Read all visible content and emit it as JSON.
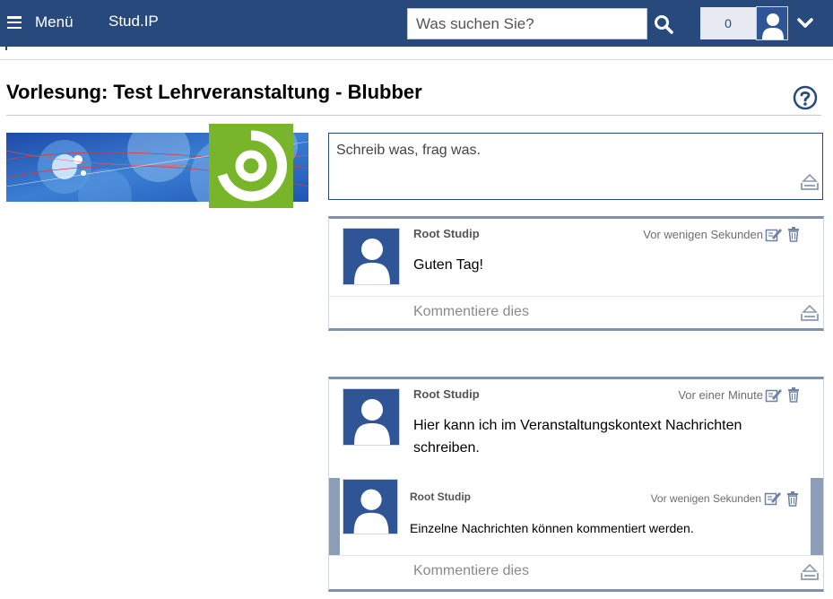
{
  "header": {
    "menu_label": "Menü",
    "brand": "Stud.IP",
    "search_placeholder": "Was suchen Sie?",
    "notification_count": "0",
    "icons": [
      "hamburger-icon",
      "search-icon",
      "avatar-icon",
      "chevron-down-icon"
    ]
  },
  "page": {
    "title": "Vorlesung: Test Lehrveranstaltung - Blubber",
    "help_icon": "help-circle-icon"
  },
  "composer": {
    "placeholder": "Schreib was, frag was.",
    "send_icon": "send-tray-icon"
  },
  "threads": [
    {
      "author": "Root Studip",
      "time": "Vor wenigen Sekunden",
      "content": "Guten Tag!",
      "comment_placeholder": "Kommentiere dies",
      "replies": []
    },
    {
      "author": "Root Studip",
      "time": "Vor einer Minute",
      "content": "Hier kann ich im Veranstaltungskontext Nachrichten schreiben.",
      "comment_placeholder": "Kommentiere dies",
      "replies": [
        {
          "author": "Root Studip",
          "time": "Vor wenigen Sekunden",
          "content": "Einzelne Nachrichten können kommentiert werden."
        }
      ]
    }
  ],
  "colors": {
    "brand_blue": "#28497c",
    "border_blue": "#7e92b0",
    "logo_green": "#79b52a"
  }
}
